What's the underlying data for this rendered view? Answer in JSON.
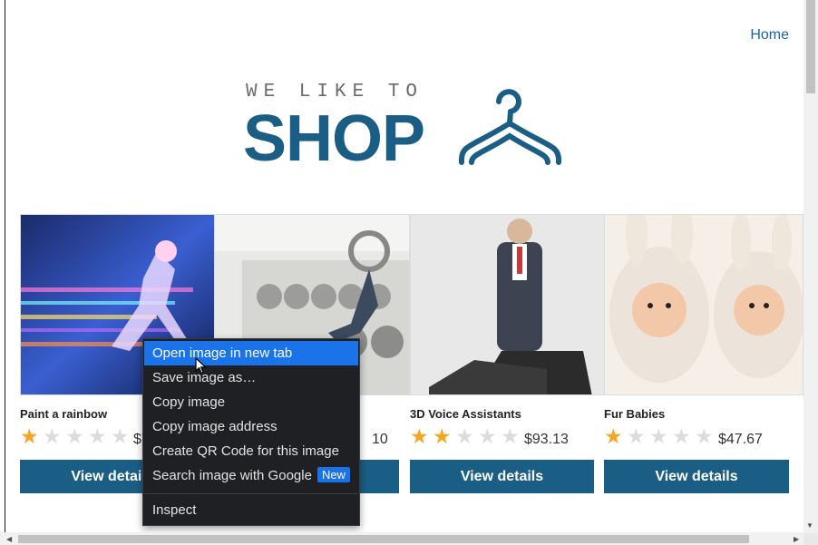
{
  "nav": {
    "home_label": "Home"
  },
  "logo": {
    "tagline": "WE LIKE TO",
    "word": "SHOP",
    "icon": "hanger-icon"
  },
  "products": [
    {
      "title": "Paint a rainbow",
      "rating": 1,
      "max_rating": 5,
      "price": "$7",
      "button_label": "View details"
    },
    {
      "title": "",
      "rating": 0,
      "max_rating": 5,
      "price": "10",
      "button_label": "View details"
    },
    {
      "title": "3D Voice Assistants",
      "rating": 2,
      "max_rating": 5,
      "price": "$93.13",
      "button_label": "View details"
    },
    {
      "title": "Fur Babies",
      "rating": 1,
      "max_rating": 5,
      "price": "$47.67",
      "button_label": "View details"
    }
  ],
  "context_menu": {
    "items": [
      {
        "label": "Open image in new tab"
      },
      {
        "label": "Save image as…"
      },
      {
        "label": "Copy image"
      },
      {
        "label": "Copy image address"
      },
      {
        "label": "Create QR Code for this image"
      },
      {
        "label": "Search image with Google",
        "badge": "New"
      },
      {
        "label": "Inspect"
      }
    ],
    "highlighted_index": 0
  },
  "colors": {
    "brand": "#1b5e85",
    "link": "#1565a6",
    "star": "#f5a623",
    "menu_bg": "#1f2024",
    "menu_highlight": "#1a73e8"
  }
}
